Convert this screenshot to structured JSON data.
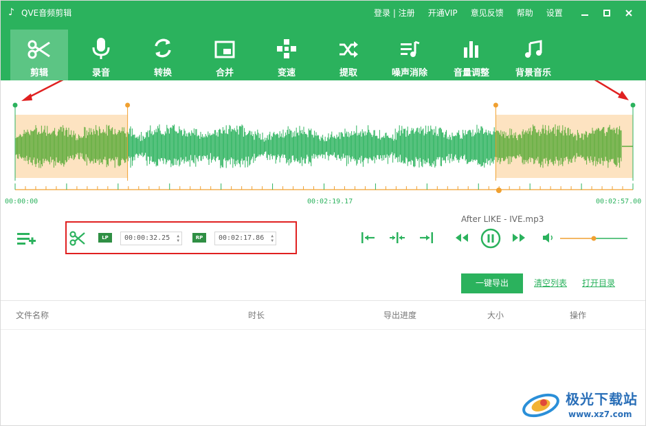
{
  "window": {
    "title": "QVE音频剪辑",
    "top_links": [
      "登录 | 注册",
      "开通VIP",
      "意见反馈",
      "帮助",
      "设置"
    ]
  },
  "toolbar": {
    "tabs": [
      {
        "label": "剪辑",
        "icon": "scissors-icon",
        "active": true
      },
      {
        "label": "录音",
        "icon": "microphone-icon"
      },
      {
        "label": "转换",
        "icon": "refresh-icon"
      },
      {
        "label": "合并",
        "icon": "picture-in-picture-icon"
      },
      {
        "label": "变速",
        "icon": "speed-icon"
      },
      {
        "label": "提取",
        "icon": "shuffle-icon"
      },
      {
        "label": "噪声消除",
        "icon": "playlist-music-icon"
      },
      {
        "label": "音量调整",
        "icon": "bar-chart-icon"
      },
      {
        "label": "背景音乐",
        "icon": "music-note-icon"
      }
    ]
  },
  "waveform": {
    "start_time": "00:00:00",
    "current_time": "00:02:19.17",
    "end_time": "00:02:57.00",
    "selection_left_fraction": 0.182,
    "selection_right_fraction": 0.778,
    "playhead_fraction": 0.783
  },
  "controls": {
    "lp_label": "LP",
    "rp_label": "RP",
    "lp_value": "00:00:32.25",
    "rp_value": "00:02:17.86",
    "file_name": "After LIKE - IVE.mp3",
    "volume_fraction": 0.5
  },
  "actions": {
    "export_label": "一键导出",
    "clear_list": "清空列表",
    "open_folder": "打开目录"
  },
  "table": {
    "headers": [
      "文件名称",
      "时长",
      "导出进度",
      "大小",
      "操作"
    ]
  },
  "watermark": {
    "title": "极光下载站",
    "url": "www.xz7.com"
  },
  "colors": {
    "accent": "#2bb25d",
    "selection_fill": "#fde3c1",
    "selection_marker": "#f0a030",
    "wave_dim": "#5fac3c",
    "annotation_red": "#e02020"
  }
}
